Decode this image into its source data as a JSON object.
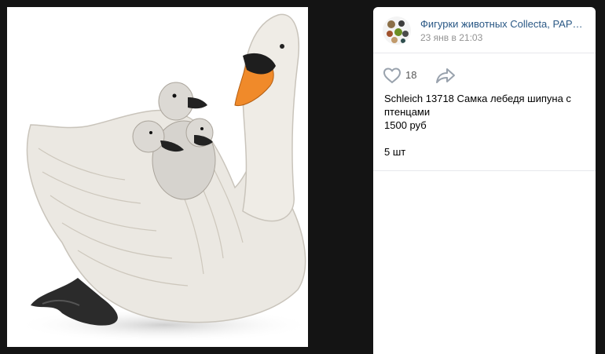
{
  "post": {
    "group_name": "Фигурки животных Collecta, PAPO, ...",
    "time": "23 янв в 21:03",
    "likes": "18",
    "text_lines": [
      "Schleich 13718 Самка лебедя шипуна с",
      "птенцами",
      "1500 руб",
      "",
      "5 шт"
    ]
  },
  "icons": {
    "like": "heart-icon",
    "share": "share-arrow-icon",
    "avatar": "group-avatar"
  },
  "colors": {
    "background": "#141414",
    "link": "#2a5885",
    "muted": "#939393",
    "icon": "#99a2ad"
  }
}
